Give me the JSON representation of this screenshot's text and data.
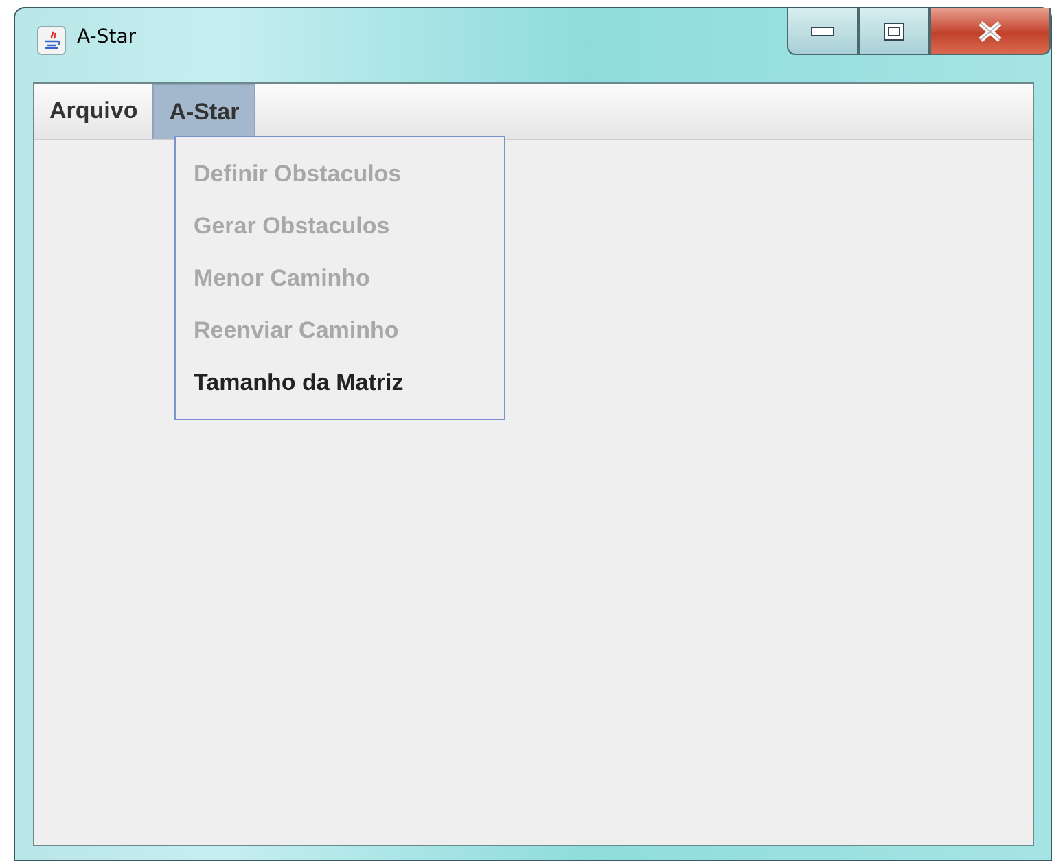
{
  "window": {
    "title": "A-Star"
  },
  "menubar": [
    {
      "label": "Arquivo",
      "selected": false
    },
    {
      "label": "A-Star",
      "selected": true
    }
  ],
  "open_menu": {
    "items": [
      {
        "label": "Definir Obstaculos",
        "disabled": true
      },
      {
        "label": "Gerar Obstaculos",
        "disabled": true
      },
      {
        "label": "Menor Caminho",
        "disabled": true
      },
      {
        "label": "Reenviar Caminho",
        "disabled": true
      },
      {
        "label": "Tamanho da Matriz",
        "disabled": false
      }
    ]
  }
}
